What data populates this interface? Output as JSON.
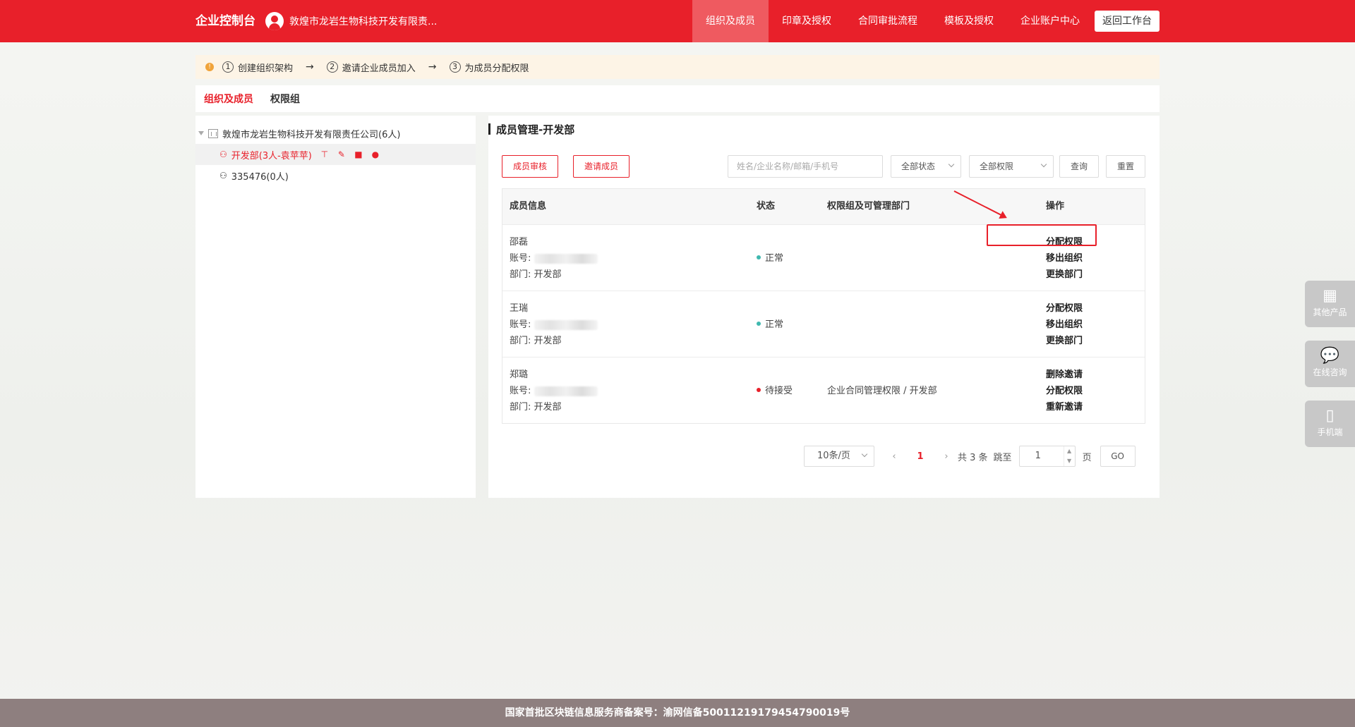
{
  "header": {
    "brand": "企业控制台",
    "company": "敦煌市龙岩生物科技开发有限责...",
    "nav": [
      "组织及成员",
      "印章及授权",
      "合同审批流程",
      "模板及授权",
      "企业账户中心"
    ],
    "back_label": "返回工作台"
  },
  "steps": {
    "warn": "!",
    "items": [
      {
        "num": "1",
        "label": "创建组织架构"
      },
      {
        "num": "2",
        "label": "邀请企业成员加入"
      },
      {
        "num": "3",
        "label": "为成员分配权限"
      }
    ],
    "arrow": "→"
  },
  "tabs": [
    "组织及成员",
    "权限组"
  ],
  "tree": {
    "root": "敦煌市龙岩生物科技开发有限责任公司(6人)",
    "children": [
      {
        "label": "开发部(3人-袁苹苹)"
      },
      {
        "label": "335476(0人)"
      }
    ]
  },
  "main": {
    "title": "成员管理-开发部",
    "review_btn": "成员审核",
    "invite_btn": "邀请成员",
    "search_placeholder": "姓名/企业名称/邮箱/手机号",
    "status_select": "全部状态",
    "perm_select": "全部权限",
    "query_btn": "查询",
    "reset_btn": "重置"
  },
  "table": {
    "headers": [
      "成员信息",
      "状态",
      "权限组及可管理部门",
      "操作"
    ],
    "account_label": "账号:",
    "dept_label": "部门:",
    "rows": [
      {
        "name": "邵磊",
        "dept": "开发部",
        "status": "正常",
        "status_color": "#3fb8af",
        "perm": "",
        "ops": [
          "分配权限",
          "移出组织",
          "更换部门"
        ]
      },
      {
        "name": "王瑞",
        "dept": "开发部",
        "status": "正常",
        "status_color": "#3fb8af",
        "perm": "",
        "ops": [
          "分配权限",
          "移出组织",
          "更换部门"
        ]
      },
      {
        "name": "郑璐",
        "dept": "开发部",
        "status": "待接受",
        "status_color": "#e8202a",
        "perm": "企业合同管理权限 / 开发部",
        "ops": [
          "删除邀请",
          "分配权限",
          "重新邀请"
        ]
      }
    ]
  },
  "pager": {
    "page_size": "10条/页",
    "prev": "‹",
    "current": "1",
    "next": "›",
    "total": "共 3 条",
    "jump_label": "跳至",
    "jump_value": "1",
    "page_unit": "页",
    "go": "GO"
  },
  "float": [
    {
      "icon": "▦",
      "label": "其他产品"
    },
    {
      "icon": "💬",
      "label": "在线咨询"
    },
    {
      "icon": "▯",
      "label": "手机端"
    }
  ],
  "footer": "国家首批区块链信息服务商备案号：渝网信备50011219179454790019号",
  "colors": {
    "accent": "#e8202a"
  }
}
